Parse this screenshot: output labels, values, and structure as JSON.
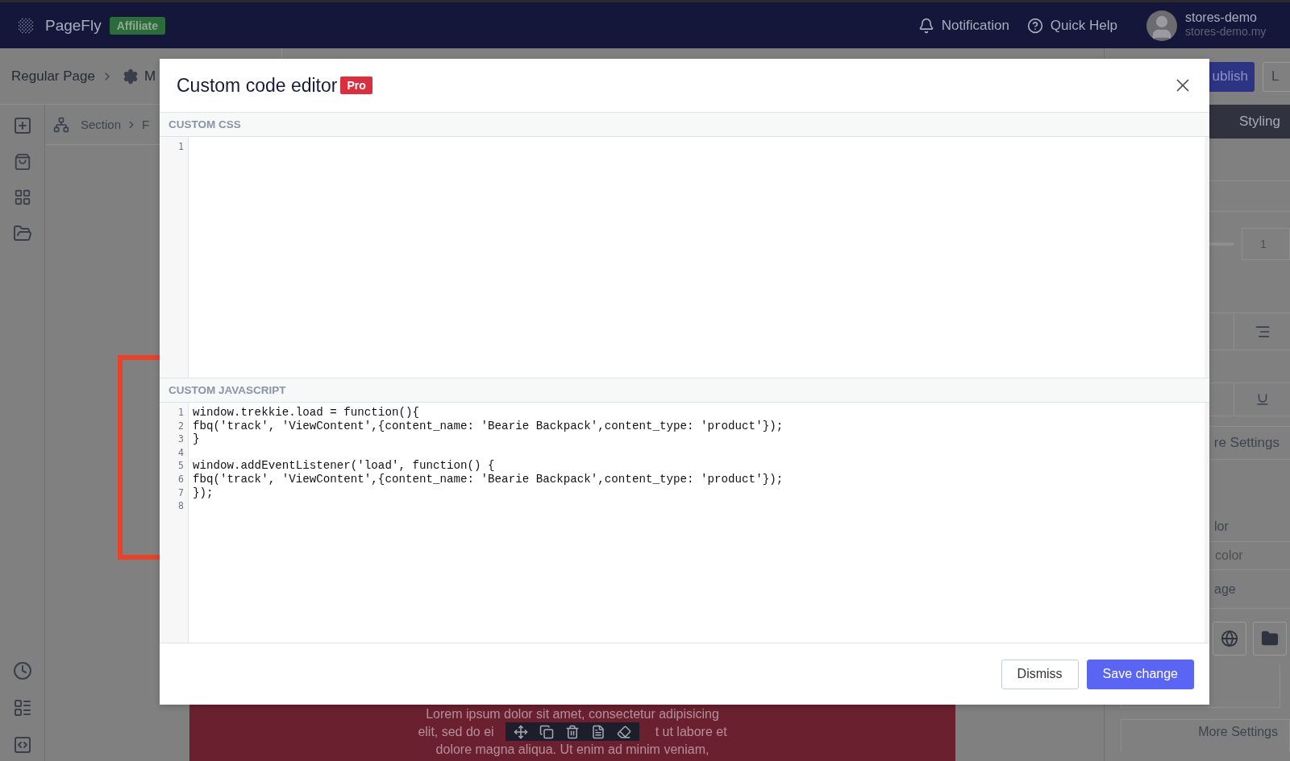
{
  "top_bar": {
    "brand": "PageFly",
    "badge": "Affiliate",
    "actions": [
      {
        "label": "Notification",
        "kind": "bell"
      },
      {
        "label": "Quick Help",
        "kind": "help"
      }
    ],
    "account": {
      "name": "stores-demo",
      "domain": "stores-demo.my"
    }
  },
  "breadcrumb": {
    "page": "Regular Page",
    "next": "M"
  },
  "section_path": {
    "first": "Section",
    "next": "F"
  },
  "header_buttons": [
    {
      "label": "ublish",
      "kind": "primary"
    },
    {
      "label": "L",
      "kind": "secondary"
    }
  ],
  "panel": {
    "tab": "Styling",
    "slider_value": "1",
    "settings_link": "re Settings",
    "color_label": "lor",
    "color_placeholder": "color",
    "image_label": "age",
    "more_settings": "More Settings"
  },
  "canvas": {
    "lines": [
      [
        "Lorem ipsum dolor sit amet, consectetur adipisicing"
      ],
      [
        "elit, sed do ei",
        "t ut labore et"
      ],
      [
        "dolore magna aliqua. Ut enim ad minim veniam,"
      ]
    ]
  },
  "modal": {
    "title": "Custom code editor",
    "badge": "Pro",
    "sections": [
      {
        "label": "CUSTOM CSS",
        "lines": [
          {
            "number": "1"
          }
        ]
      },
      {
        "label": "CUSTOM JAVASCRIPT",
        "lines": [
          {
            "number": "1",
            "code": "window.trekkie.load = function(){"
          },
          {
            "number": "2",
            "code": "fbq('track', 'ViewContent',{content_name: 'Bearie Backpack',content_type: 'product'});"
          },
          {
            "number": "3",
            "code": "}"
          },
          {
            "number": "4"
          },
          {
            "number": "5",
            "code": "window.addEventListener('load', function() {"
          },
          {
            "number": "6",
            "code": "fbq('track', 'ViewContent',{content_name: 'Bearie Backpack',content_type: 'product'});"
          },
          {
            "number": "7",
            "code": "});"
          },
          {
            "number": "8"
          }
        ]
      }
    ],
    "buttons": [
      {
        "label": "Dismiss",
        "kind": "secondary"
      },
      {
        "label": "Save change",
        "kind": "primary"
      }
    ]
  }
}
